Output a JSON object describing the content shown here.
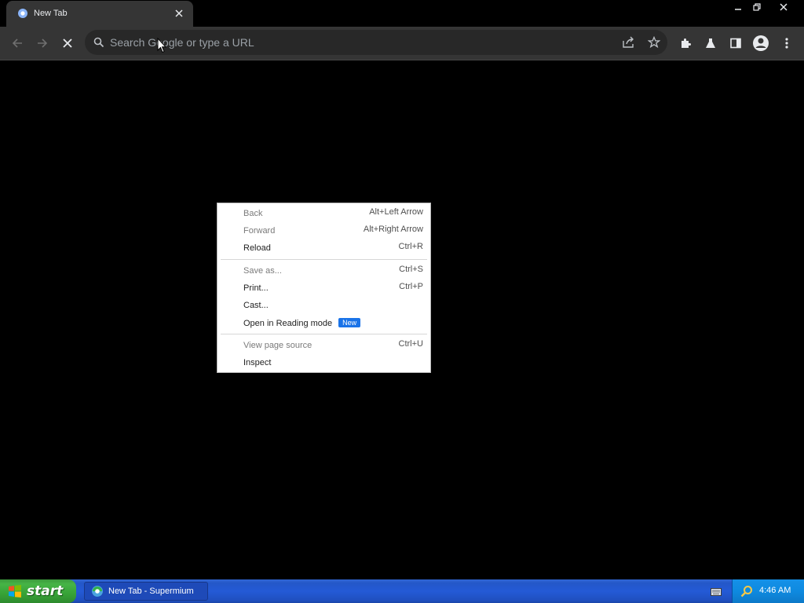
{
  "tab": {
    "title": "New Tab"
  },
  "omnibox": {
    "placeholder": "Search Google or type a URL"
  },
  "context_menu": {
    "items": [
      {
        "label": "Back",
        "shortcut": "Alt+Left Arrow",
        "enabled": false
      },
      {
        "label": "Forward",
        "shortcut": "Alt+Right Arrow",
        "enabled": false
      },
      {
        "label": "Reload",
        "shortcut": "Ctrl+R",
        "enabled": true
      },
      {
        "label": "Save as...",
        "shortcut": "Ctrl+S",
        "enabled": false
      },
      {
        "label": "Print...",
        "shortcut": "Ctrl+P",
        "enabled": true
      },
      {
        "label": "Cast...",
        "shortcut": "",
        "enabled": true
      },
      {
        "label": "Open in Reading mode",
        "badge": "New",
        "shortcut": "",
        "enabled": true
      },
      {
        "label": "View page source",
        "shortcut": "Ctrl+U",
        "enabled": false
      },
      {
        "label": "Inspect",
        "shortcut": "",
        "enabled": true
      }
    ]
  },
  "taskbar": {
    "start_label": "start",
    "task_label": "New Tab - Supermium",
    "clock": "4:46 AM"
  },
  "colors": {
    "toolbar": "#353535",
    "omnibox": "#282828",
    "badge": "#1a73e8",
    "taskbar": "#245ad6",
    "start": "#3c9a3c"
  }
}
